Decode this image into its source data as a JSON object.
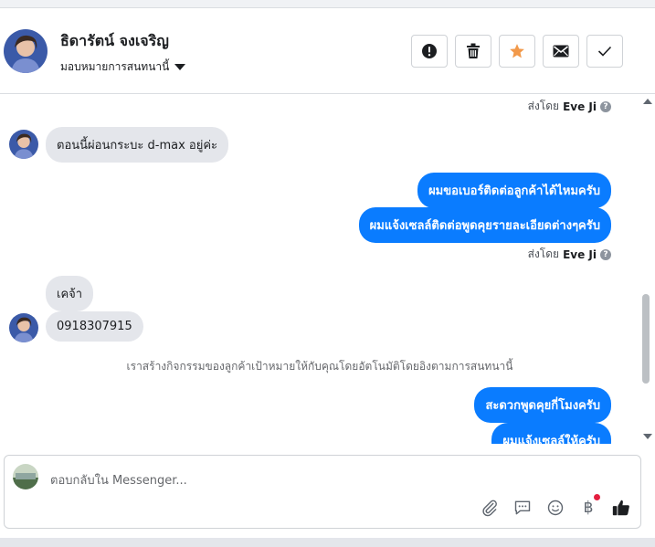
{
  "header": {
    "contact_name": "ธิดารัตน์ จงเจริญ",
    "assign_label": "มอบหมายการสนทนานี้",
    "actions": [
      {
        "name": "report-spam",
        "icon": "exclamation-circle-icon"
      },
      {
        "name": "delete",
        "icon": "trash-icon"
      },
      {
        "name": "follow-up",
        "icon": "star-icon",
        "color": "#f2994a"
      },
      {
        "name": "mark-unread",
        "icon": "envelope-icon"
      },
      {
        "name": "mark-done",
        "icon": "checkmark-icon"
      }
    ]
  },
  "messages": {
    "sent_by_prefix": "ส่งโดย",
    "sent_by_name": "Eve Ji",
    "m1": "ตอนนี้ผ่อนกระบะ d-max อยู่ค่ะ",
    "m2": "ผมขอเบอร์ติดต่อลูกค้าได้ไหมครับ",
    "m3": "ผมแจ้งเซลล์ติดต่อพูดคุยรายละเอียดต่างๆครับ",
    "m4": "เคจ้า",
    "m5": "0918307915",
    "notice": "เราสร้างกิจกรรมของลูกค้าเป้าหมายให้กับคุณโดยอัตโนมัติโดยอิงตามการสนทนานี้",
    "m6": "สะดวกพูดคุยกี่โมงครับ",
    "m7": "ผมแจ้งเซลล์ให้ครับ"
  },
  "composer": {
    "placeholder": "ตอบกลับใน Messenger...",
    "tools": [
      "paperclip-icon",
      "saved-reply-icon",
      "emoji-icon",
      "baht-icon",
      "thumbs-up-icon"
    ],
    "baht_glyph": "฿"
  },
  "colors": {
    "outgoing_bubble": "#0a7cff",
    "incoming_bubble": "#e4e6eb",
    "star": "#f2994a"
  }
}
